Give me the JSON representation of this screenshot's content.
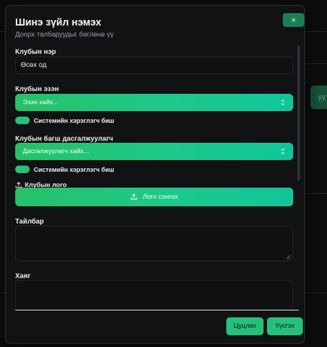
{
  "background": {
    "peek_text": "уу"
  },
  "modal": {
    "title": "Шинэ зүйл нэмэх",
    "subtitle": "Доорх талбаруудыг бөглөнө үү",
    "close_label": "×"
  },
  "fields": {
    "club_name": {
      "label": "Клубын нэр",
      "value": "Өсөх од"
    },
    "club_owner": {
      "label": "Клубын эзэн",
      "placeholder": "Эзэн хайх...",
      "toggle_label": "Системийн хэрэглэгч биш"
    },
    "club_coach": {
      "label": "Клубын багш дасгалжуулагч",
      "placeholder": "Дасгалжуулагч хайх...",
      "toggle_label": "Системийн хэрэглэгч биш"
    },
    "club_logo": {
      "label": "Клубын лого",
      "button_label": "Лого сонгох"
    },
    "description": {
      "label": "Тайлбар",
      "value": ""
    },
    "address": {
      "label": "Хаяг",
      "value": ""
    }
  },
  "footer": {
    "cancel_label": "Цуцлах",
    "create_label": "Үүсгэх"
  },
  "colors": {
    "accent": "#25c07a",
    "gradient_start": "#27c167",
    "gradient_end": "#0fc69a",
    "modal_bg": "#111214"
  }
}
